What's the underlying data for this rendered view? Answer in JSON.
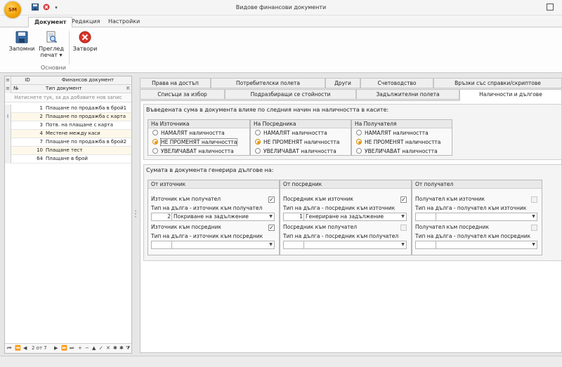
{
  "app": {
    "logo": "SM",
    "window_title": "Видове финансови документи"
  },
  "quick_access": [
    "save-icon",
    "close-icon",
    "dropdown-icon"
  ],
  "ribbon": {
    "tabs": [
      "Документ",
      "Редакция",
      "Настройки"
    ],
    "active_tab": "Документ",
    "buttons": {
      "save": "Запомни",
      "preview_line1": "Преглед",
      "preview_line2": "печат ▾",
      "close": "Затвори"
    },
    "group_label": "Основни"
  },
  "grid": {
    "header": {
      "id": "ID",
      "name": "Финансов документ"
    },
    "subheader": {
      "no": "№",
      "type": "Тип документ",
      "k": "К"
    },
    "new_row_hint": "Натиснете тук, за да добавите нов запис",
    "rows": [
      {
        "no": "1",
        "name": "Плащане по продажба в брой1",
        "ind": ""
      },
      {
        "no": "2",
        "name": "Плащане по продажба с карта",
        "ind": "I"
      },
      {
        "no": "3",
        "name": "Потв. на плащане с карта",
        "ind": ""
      },
      {
        "no": "4",
        "name": "Местене между каси",
        "ind": ""
      },
      {
        "no": "7",
        "name": "Плащане по продажба в брой2",
        "ind": ""
      },
      {
        "no": "10",
        "name": "Плащане тест",
        "ind": ""
      },
      {
        "no": "64",
        "name": "Плащане в брой",
        "ind": ""
      }
    ],
    "navigator": {
      "position": "2 от 7"
    }
  },
  "tabs_row1": [
    "Права на достъп",
    "Потребителски полета",
    "Други",
    "Счетоводство",
    "Връзки със справки/скриптове"
  ],
  "tabs_row2": [
    "Списъци за избор",
    "Подразбиращи се стойности",
    "Задължителни полета",
    "Наличности и дългове"
  ],
  "active_tab": "Наличности и дългове",
  "stock": {
    "title": "Въведената сума в документа влияе по следния начин на наличността в касите:",
    "groups": [
      {
        "title": "На Източника",
        "options": [
          "НАМАЛЯТ наличността",
          "НЕ ПРОМЕНЯТ наличността",
          "УВЕЛИЧАВАТ наличността"
        ],
        "selected": 1
      },
      {
        "title": "На Посредника",
        "options": [
          "НАМАЛЯТ наличността",
          "НЕ ПРОМЕНЯТ наличността",
          "УВЕЛИЧАВАТ наличността"
        ],
        "selected": 1
      },
      {
        "title": "На Получателя",
        "options": [
          "НАМАЛЯТ наличността",
          "НЕ ПРОМЕНЯТ наличността",
          "УВЕЛИЧАВАТ наличността"
        ],
        "selected": 1
      }
    ]
  },
  "debts": {
    "title": "Сумата в документа генерира дългове на:",
    "groups": [
      {
        "title": "От източник",
        "cb1": {
          "label": "Източник към получател",
          "checked": "✓"
        },
        "type1_label": "Тип на дълга - източник към получател",
        "type1": {
          "num": "2",
          "text": "Покриване на задължение"
        },
        "cb2": {
          "label": "Източник към посредник",
          "checked": "✓"
        },
        "type2_label": "Тип на дълга - източник към посредник",
        "type2": {
          "num": "",
          "text": ""
        }
      },
      {
        "title": "От посредник",
        "cb1": {
          "label": "Посредник към източник",
          "checked": "✓"
        },
        "type1_label": "Тип на дълга - посредник към източник",
        "type1": {
          "num": "1",
          "text": "Генериране на задължение"
        },
        "cb2": {
          "label": "Посредник към получател",
          "checked": ""
        },
        "type2_label": "Тип на дълга - посредник към получател",
        "type2": {
          "num": "",
          "text": ""
        }
      },
      {
        "title": "От получател",
        "cb1": {
          "label": "Получател към източник",
          "checked": ""
        },
        "type1_label": "Тип на дълга - получател към източник",
        "type1": {
          "num": "",
          "text": ""
        },
        "cb2": {
          "label": "Получател към посредник",
          "checked": ""
        },
        "type2_label": "Тип на дълга - получател към посредник",
        "type2": {
          "num": "",
          "text": ""
        }
      }
    ]
  }
}
